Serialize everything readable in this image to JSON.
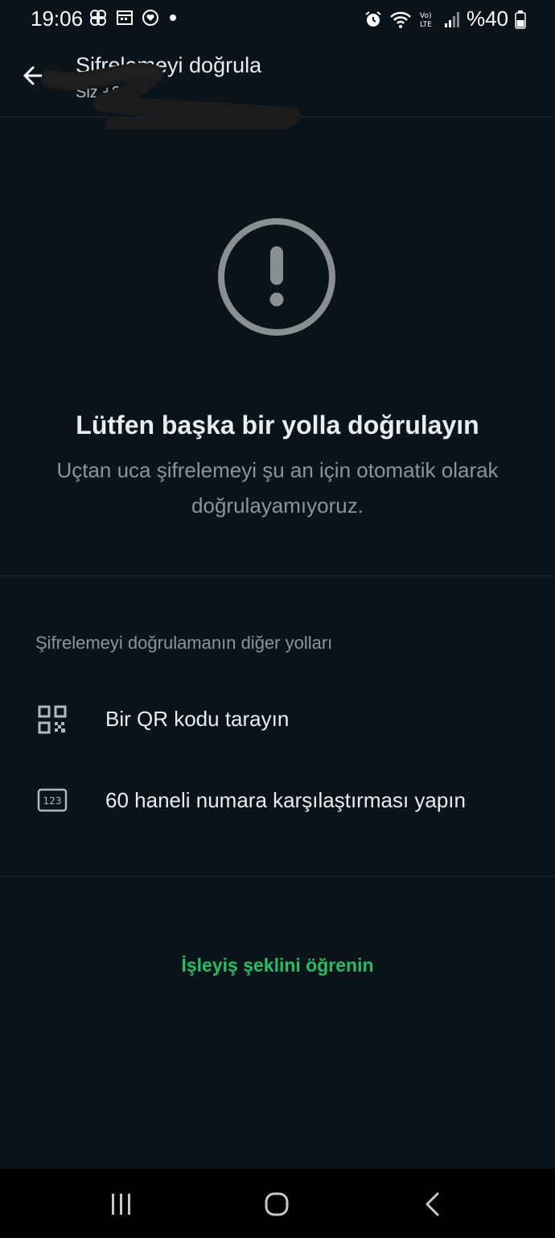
{
  "status_bar": {
    "time": "19:06",
    "battery": "%40",
    "left_icons": [
      "pinwheel-icon",
      "calendar-icon",
      "heart-circle-icon",
      "dot-icon"
    ],
    "right_icons": [
      "alarm-icon",
      "wifi-icon",
      "volte-icon",
      "signal-icon",
      "battery-icon"
    ]
  },
  "app_bar": {
    "title": "Şifrelemeyi doğrula",
    "subtitle": "Siz +9"
  },
  "warning": {
    "headline": "Lütfen başka bir yolla doğrulayın",
    "description": "Uçtan uca şifrelemeyi şu an için otomatik olarak doğrulayamıyoruz."
  },
  "other_ways": {
    "section_label": "Şifrelemeyi doğrulamanın diğer yolları",
    "options": [
      {
        "label": "Bir QR kodu tarayın",
        "icon": "qr-code-icon"
      },
      {
        "label": "60 haneli numara karşılaştırması yapın",
        "icon": "number-123-icon"
      }
    ]
  },
  "learn_more": "İşleyiş şeklini öğrenin",
  "colors": {
    "background": "#0b141a",
    "accent": "#21c063",
    "text_primary": "#e9edef",
    "text_secondary": "#8696a0",
    "icon_gray": "#8a8f92"
  }
}
